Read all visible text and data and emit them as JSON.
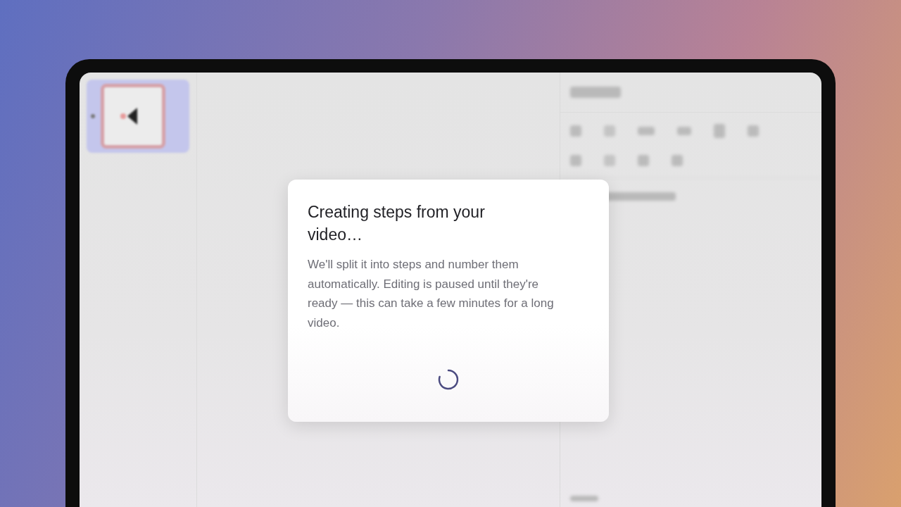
{
  "sidebar": {
    "thumbnails": [
      {
        "selected": true
      }
    ]
  },
  "dialog": {
    "title": "Creating steps from your video…",
    "message": "We'll split it into steps and number them automatically. Editing is paused until they're ready — this can take a few minutes for a long video.",
    "loading": true
  }
}
